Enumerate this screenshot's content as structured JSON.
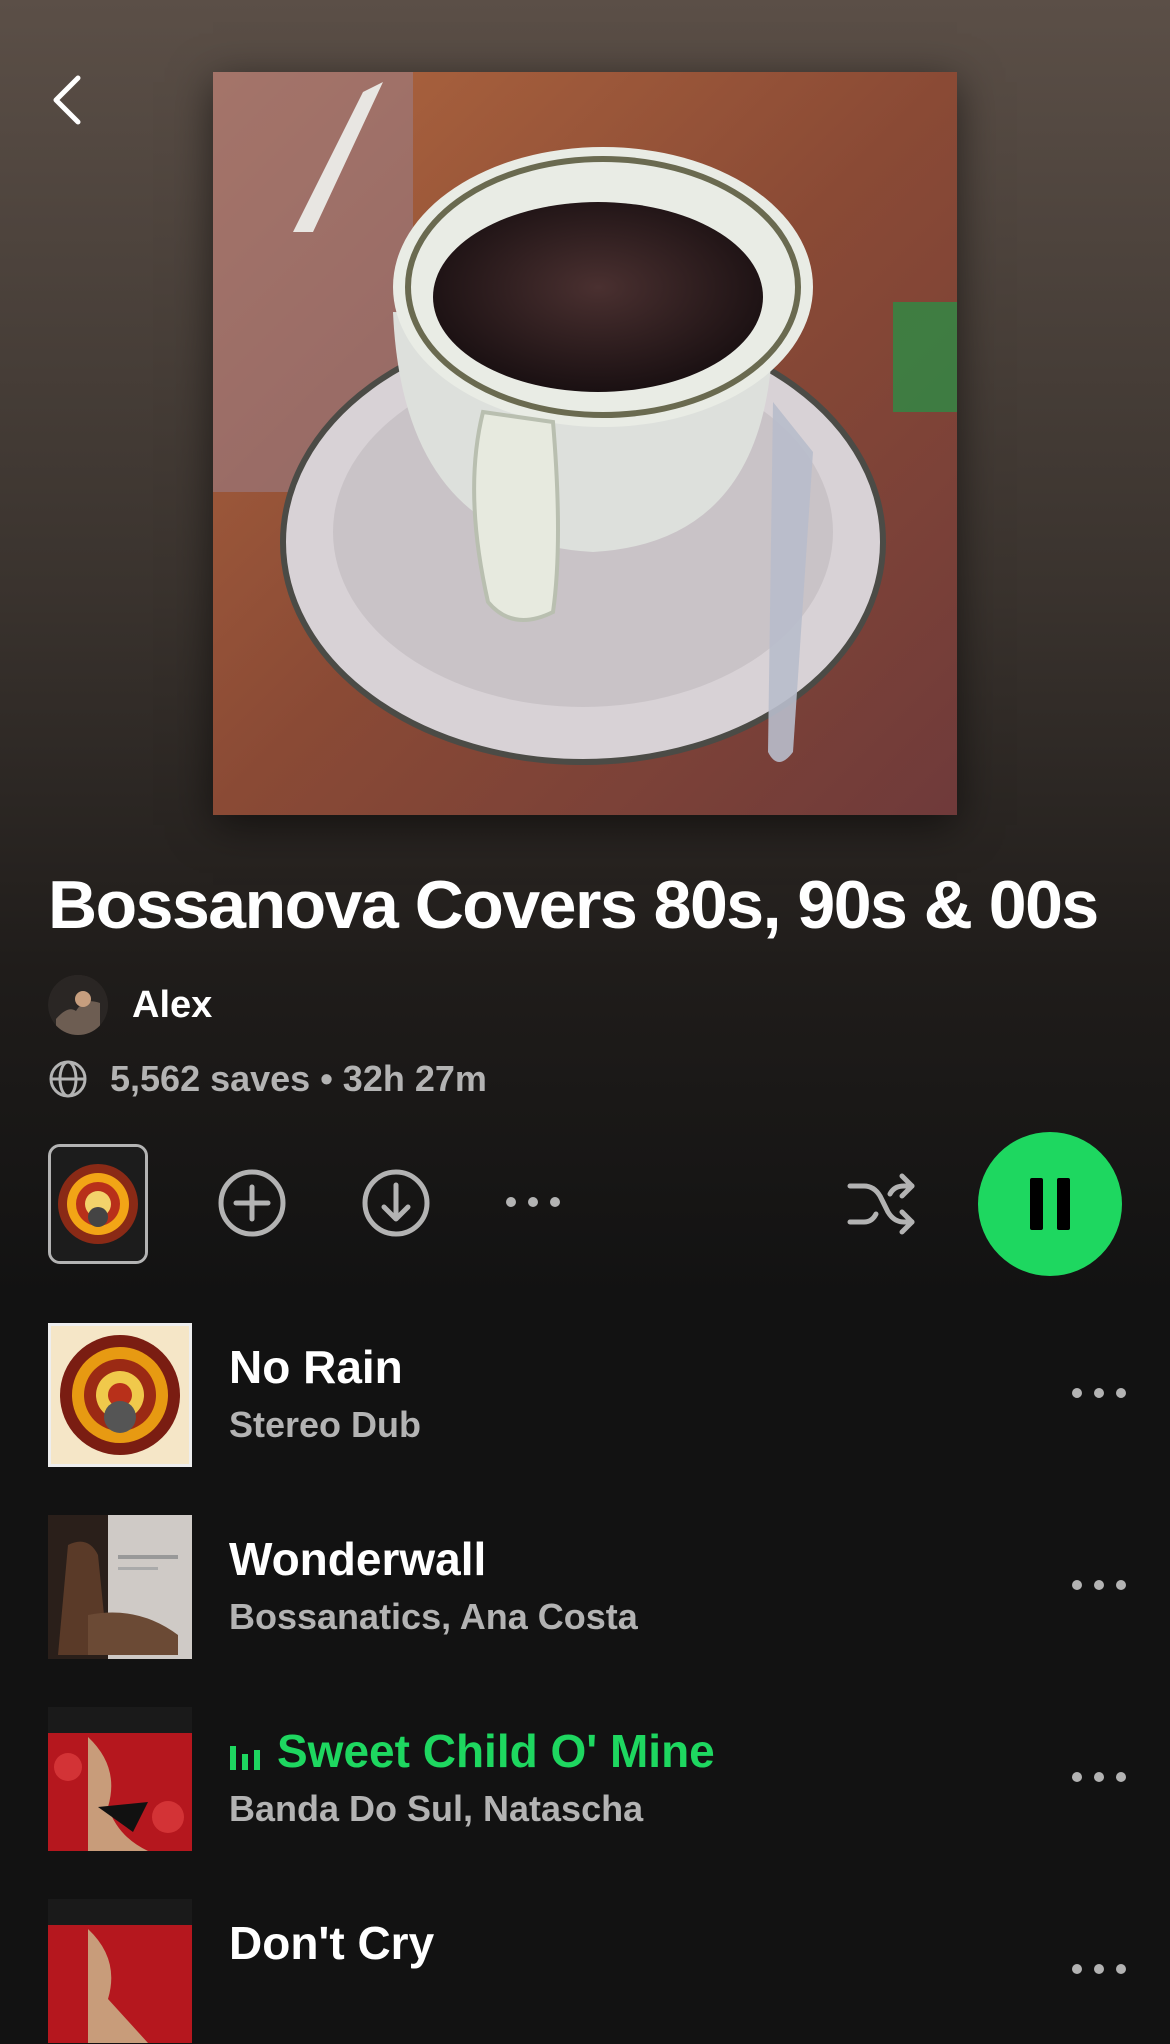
{
  "playlist": {
    "title": "Bossanova Covers 80s, 90s & 00s",
    "owner": "Alex",
    "meta": "5,562 saves • 32h 27m"
  },
  "colors": {
    "accent": "#1ed760",
    "background": "#121212",
    "secondary_text": "#b3b3b3"
  },
  "icons": {
    "back": "chevron-left-icon",
    "visibility": "globe-icon",
    "add": "add-circle-icon",
    "download": "download-circle-icon",
    "more": "more-horizontal-icon",
    "shuffle": "shuffle-icon",
    "pause": "pause-icon"
  },
  "tracks": [
    {
      "title": "No Rain",
      "artist": "Stereo Dub",
      "playing": false
    },
    {
      "title": "Wonderwall",
      "artist": "Bossanatics, Ana Costa",
      "playing": false
    },
    {
      "title": "Sweet Child O' Mine",
      "artist": "Banda Do Sul, Natascha",
      "playing": true
    },
    {
      "title": "Don't Cry",
      "artist": "",
      "playing": false
    }
  ]
}
